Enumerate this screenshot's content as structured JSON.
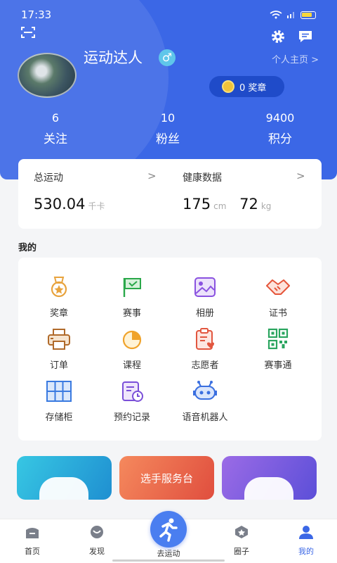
{
  "status_bar": {
    "time": "17:33"
  },
  "profile": {
    "name": "运动达人",
    "gender_symbol": "♂",
    "homepage_link": "个人主页 >",
    "medals": "0 奖章"
  },
  "stats": [
    {
      "value": "6",
      "label": "关注"
    },
    {
      "value": "10",
      "label": "粉丝"
    },
    {
      "value": "9400",
      "label": "积分"
    }
  ],
  "summary": {
    "exercise": {
      "title": "总运动",
      "value": "530.04",
      "unit": "千卡",
      "arrow": ">"
    },
    "health": {
      "title": "健康数据",
      "height": "175",
      "height_unit": "cm",
      "weight": "72",
      "weight_unit": "kg",
      "arrow": ">"
    }
  },
  "mine": {
    "title": "我的",
    "items": [
      {
        "label": "奖章",
        "icon": "medal-icon"
      },
      {
        "label": "赛事",
        "icon": "flag-icon"
      },
      {
        "label": "相册",
        "icon": "album-icon"
      },
      {
        "label": "证书",
        "icon": "handshake-icon"
      },
      {
        "label": "订单",
        "icon": "printer-icon"
      },
      {
        "label": "课程",
        "icon": "pie-icon"
      },
      {
        "label": "志愿者",
        "icon": "clipboard-heart-icon"
      },
      {
        "label": "赛事通",
        "icon": "qrcode-icon"
      },
      {
        "label": "存储柜",
        "icon": "locker-icon"
      },
      {
        "label": "预约记录",
        "icon": "calendar-clock-icon"
      },
      {
        "label": "语音机器人",
        "icon": "robot-icon"
      }
    ]
  },
  "banners": [
    {
      "text": "",
      "color": "#2bb3d6"
    },
    {
      "text": "选手服务台",
      "color": "#ec6a4a"
    },
    {
      "text": "",
      "color": "#7a5ee0"
    }
  ],
  "tabs": [
    {
      "label": "首页",
      "icon": "home-icon",
      "active": false
    },
    {
      "label": "发现",
      "icon": "discover-icon",
      "active": false
    },
    {
      "label": "去运动",
      "icon": "runner-icon",
      "active": false
    },
    {
      "label": "圈子",
      "icon": "circle-icon",
      "active": false
    },
    {
      "label": "我的",
      "icon": "user-icon",
      "active": true
    }
  ],
  "colors": {
    "primary": "#3b67e6",
    "background": "#f4f5f7"
  }
}
